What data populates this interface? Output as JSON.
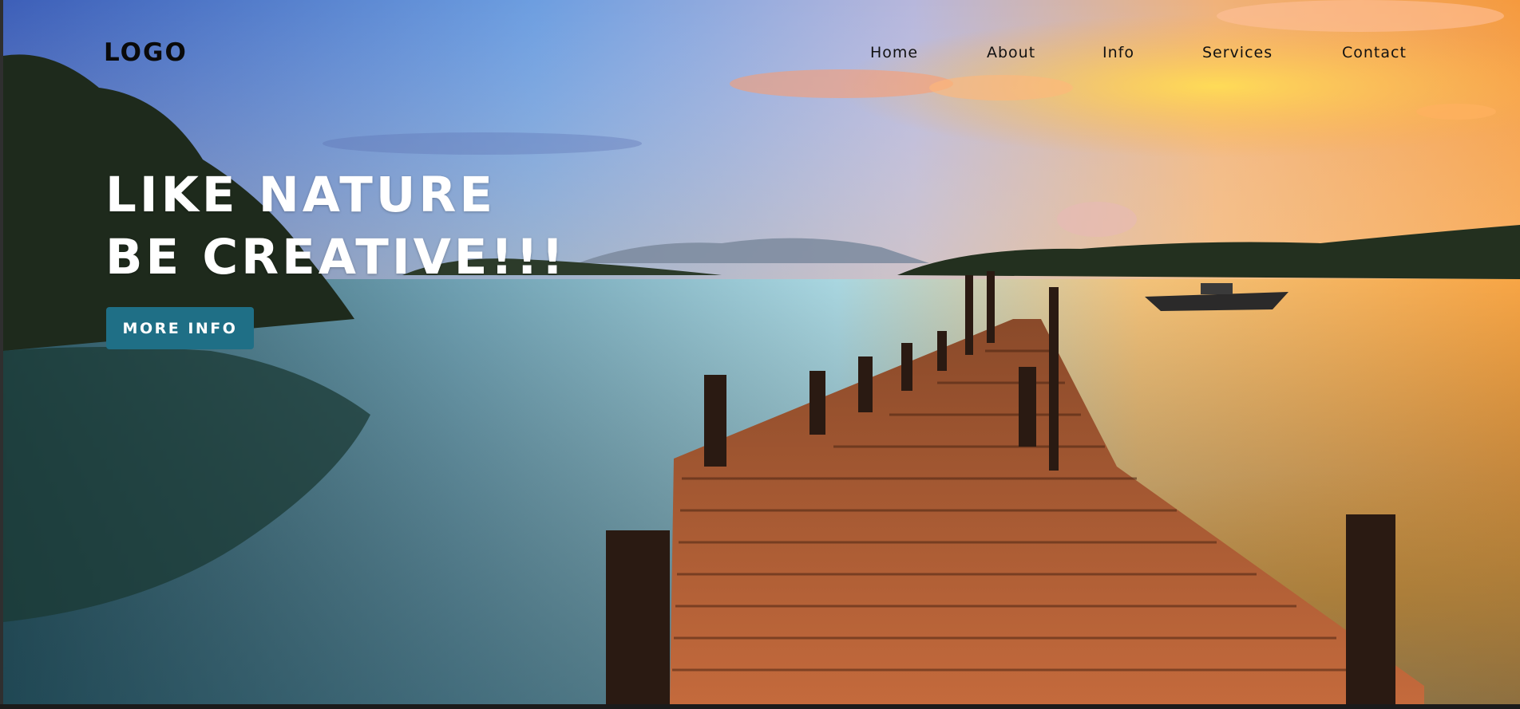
{
  "brand": {
    "logo_text": "LOGO"
  },
  "nav": {
    "items": [
      {
        "label": "Home"
      },
      {
        "label": "About"
      },
      {
        "label": "Info"
      },
      {
        "label": "Services"
      },
      {
        "label": "Contact"
      }
    ]
  },
  "hero": {
    "headline_line1": "LIKE NATURE",
    "headline_line2": "BE CREATIVE!!!",
    "cta_label": "MORE INFO",
    "background_image": "lake-sunset-wooden-pier-photo"
  },
  "colors": {
    "accent": "#1f6f86",
    "headline": "#ffffff",
    "nav_text": "#111111"
  }
}
